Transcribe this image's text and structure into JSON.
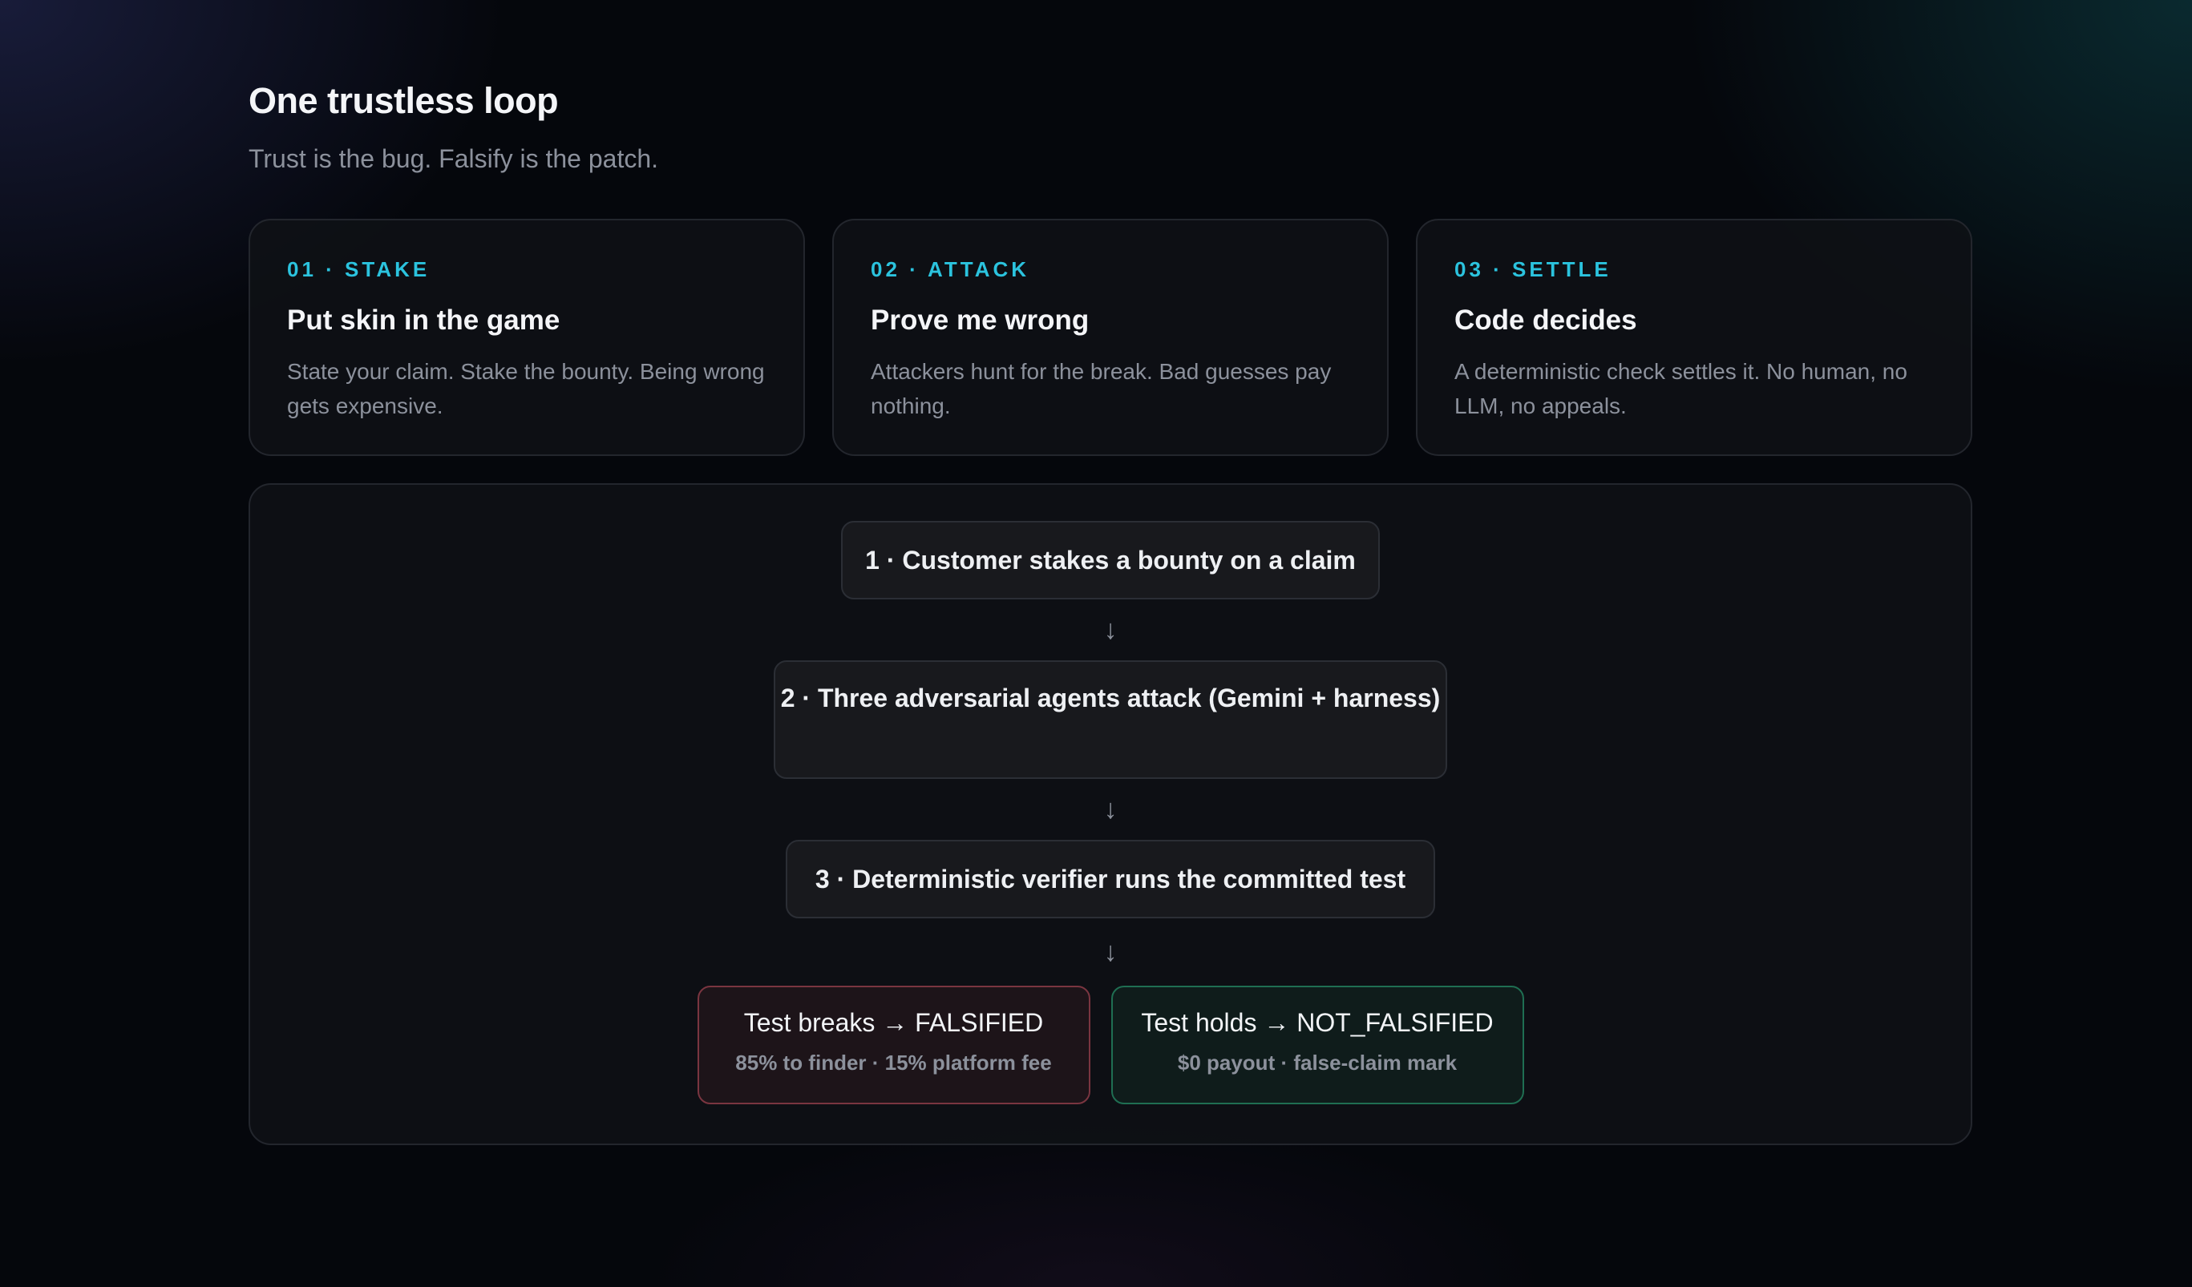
{
  "header": {
    "title": "One trustless loop",
    "subtitle": "Trust is the bug. Falsify is the patch."
  },
  "cards": [
    {
      "tag": "01 · STAKE",
      "title": "Put skin in the game",
      "description": "State your claim. Stake the bounty. Being wrong gets expensive."
    },
    {
      "tag": "02 · ATTACK",
      "title": "Prove me wrong",
      "description": "Attackers hunt for the break. Bad guesses pay nothing."
    },
    {
      "tag": "03 · SETTLE",
      "title": "Code decides",
      "description": "A deterministic check settles it. No human, no LLM, no appeals."
    }
  ],
  "flow": {
    "steps": [
      "1 · Customer stakes a bounty on a claim",
      "2 · Three adversarial agents attack (Gemini + harness)",
      "3 · Deterministic verifier runs the committed test"
    ],
    "arrow": "↓",
    "outcomes": {
      "falsified": {
        "title": "Test breaks → FALSIFIED",
        "detail": "85% to finder · 15% platform fee",
        "border_color": "#7a3540"
      },
      "not_falsified": {
        "title": "Test holds → NOT_FALSIFIED",
        "detail": "$0 payout · false-claim mark",
        "border_color": "#1f6e52"
      }
    }
  },
  "colors": {
    "accent": "#2bc3de",
    "background": "#05070c",
    "muted_text": "#8c919c"
  }
}
